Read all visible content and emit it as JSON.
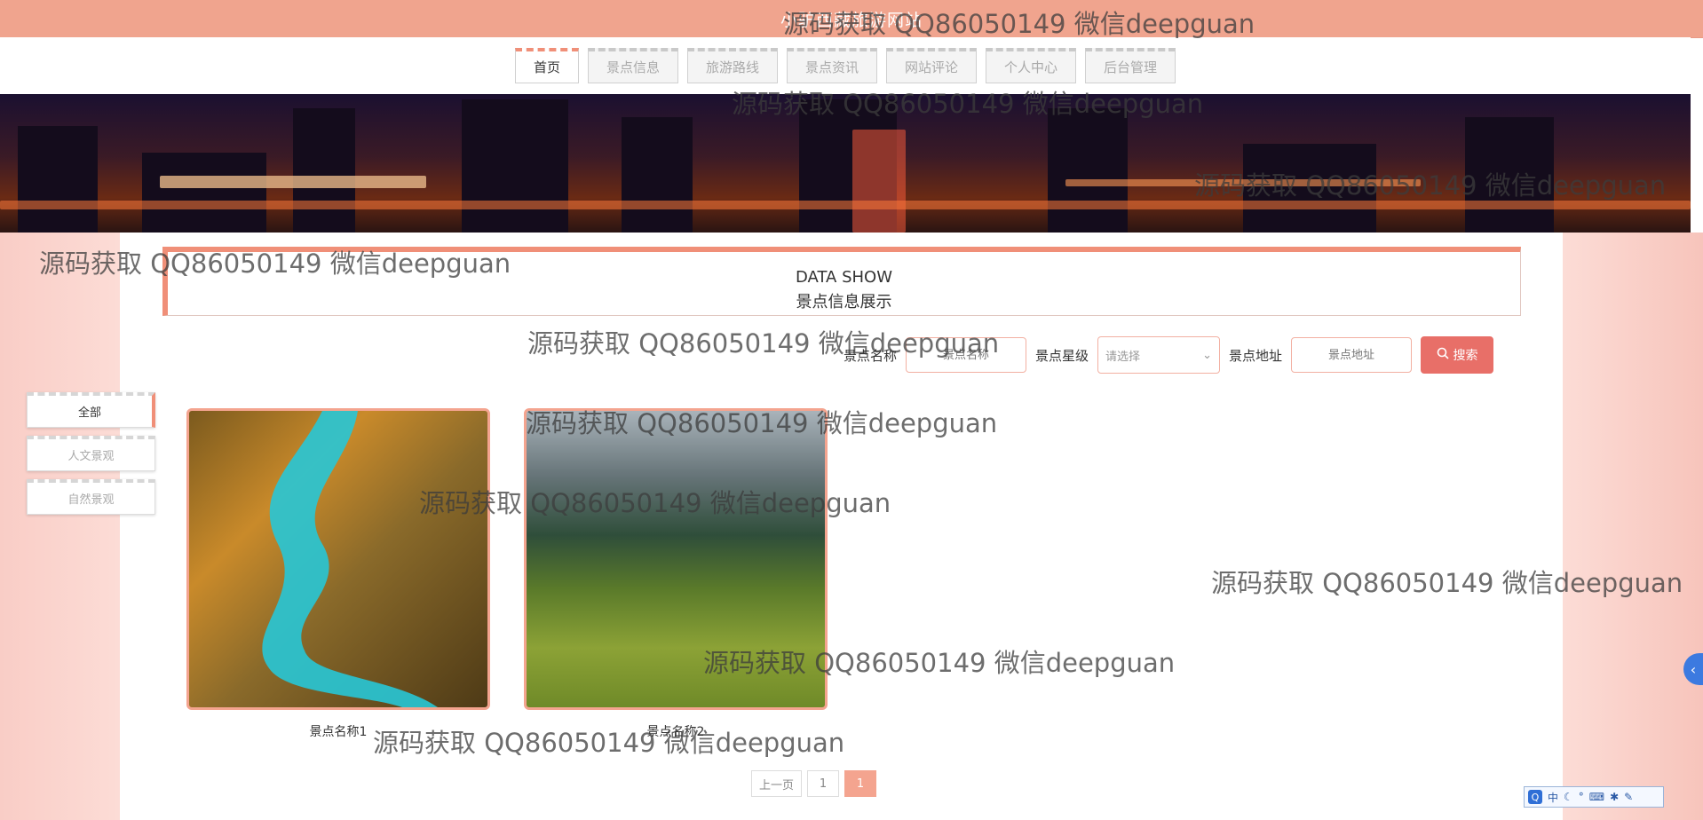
{
  "header": {
    "title": "小驴西藏旅游网站"
  },
  "nav": {
    "tabs": [
      {
        "label": "首页",
        "active": true
      },
      {
        "label": "景点信息",
        "active": false
      },
      {
        "label": "旅游路线",
        "active": false
      },
      {
        "label": "景点资讯",
        "active": false
      },
      {
        "label": "网站评论",
        "active": false
      },
      {
        "label": "个人中心",
        "active": false
      },
      {
        "label": "后台管理",
        "active": false
      }
    ]
  },
  "section": {
    "title_en": "DATA SHOW",
    "title_cn": "景点信息展示"
  },
  "search": {
    "name_label": "景点名称",
    "name_placeholder": "景点名称",
    "level_label": "景点星级",
    "level_selected": "请选择",
    "address_label": "景点地址",
    "address_placeholder": "景点地址",
    "button_label": "搜索"
  },
  "categories": [
    {
      "label": "全部",
      "active": true
    },
    {
      "label": "人文景观",
      "active": false
    },
    {
      "label": "自然景观",
      "active": false
    }
  ],
  "cards": [
    {
      "name": "景点名称1"
    },
    {
      "name": "景点名称2"
    }
  ],
  "pagination": {
    "prev": "上一页",
    "page": "1",
    "current": "1"
  },
  "watermark": "源码获取 QQ86050149 微信deepguan",
  "ime": {
    "lang": "中"
  },
  "colors": {
    "accent": "#f08f78",
    "button": "#e86f68",
    "topbar": "#f0a48e",
    "page_bg": "#fbd6d0"
  }
}
